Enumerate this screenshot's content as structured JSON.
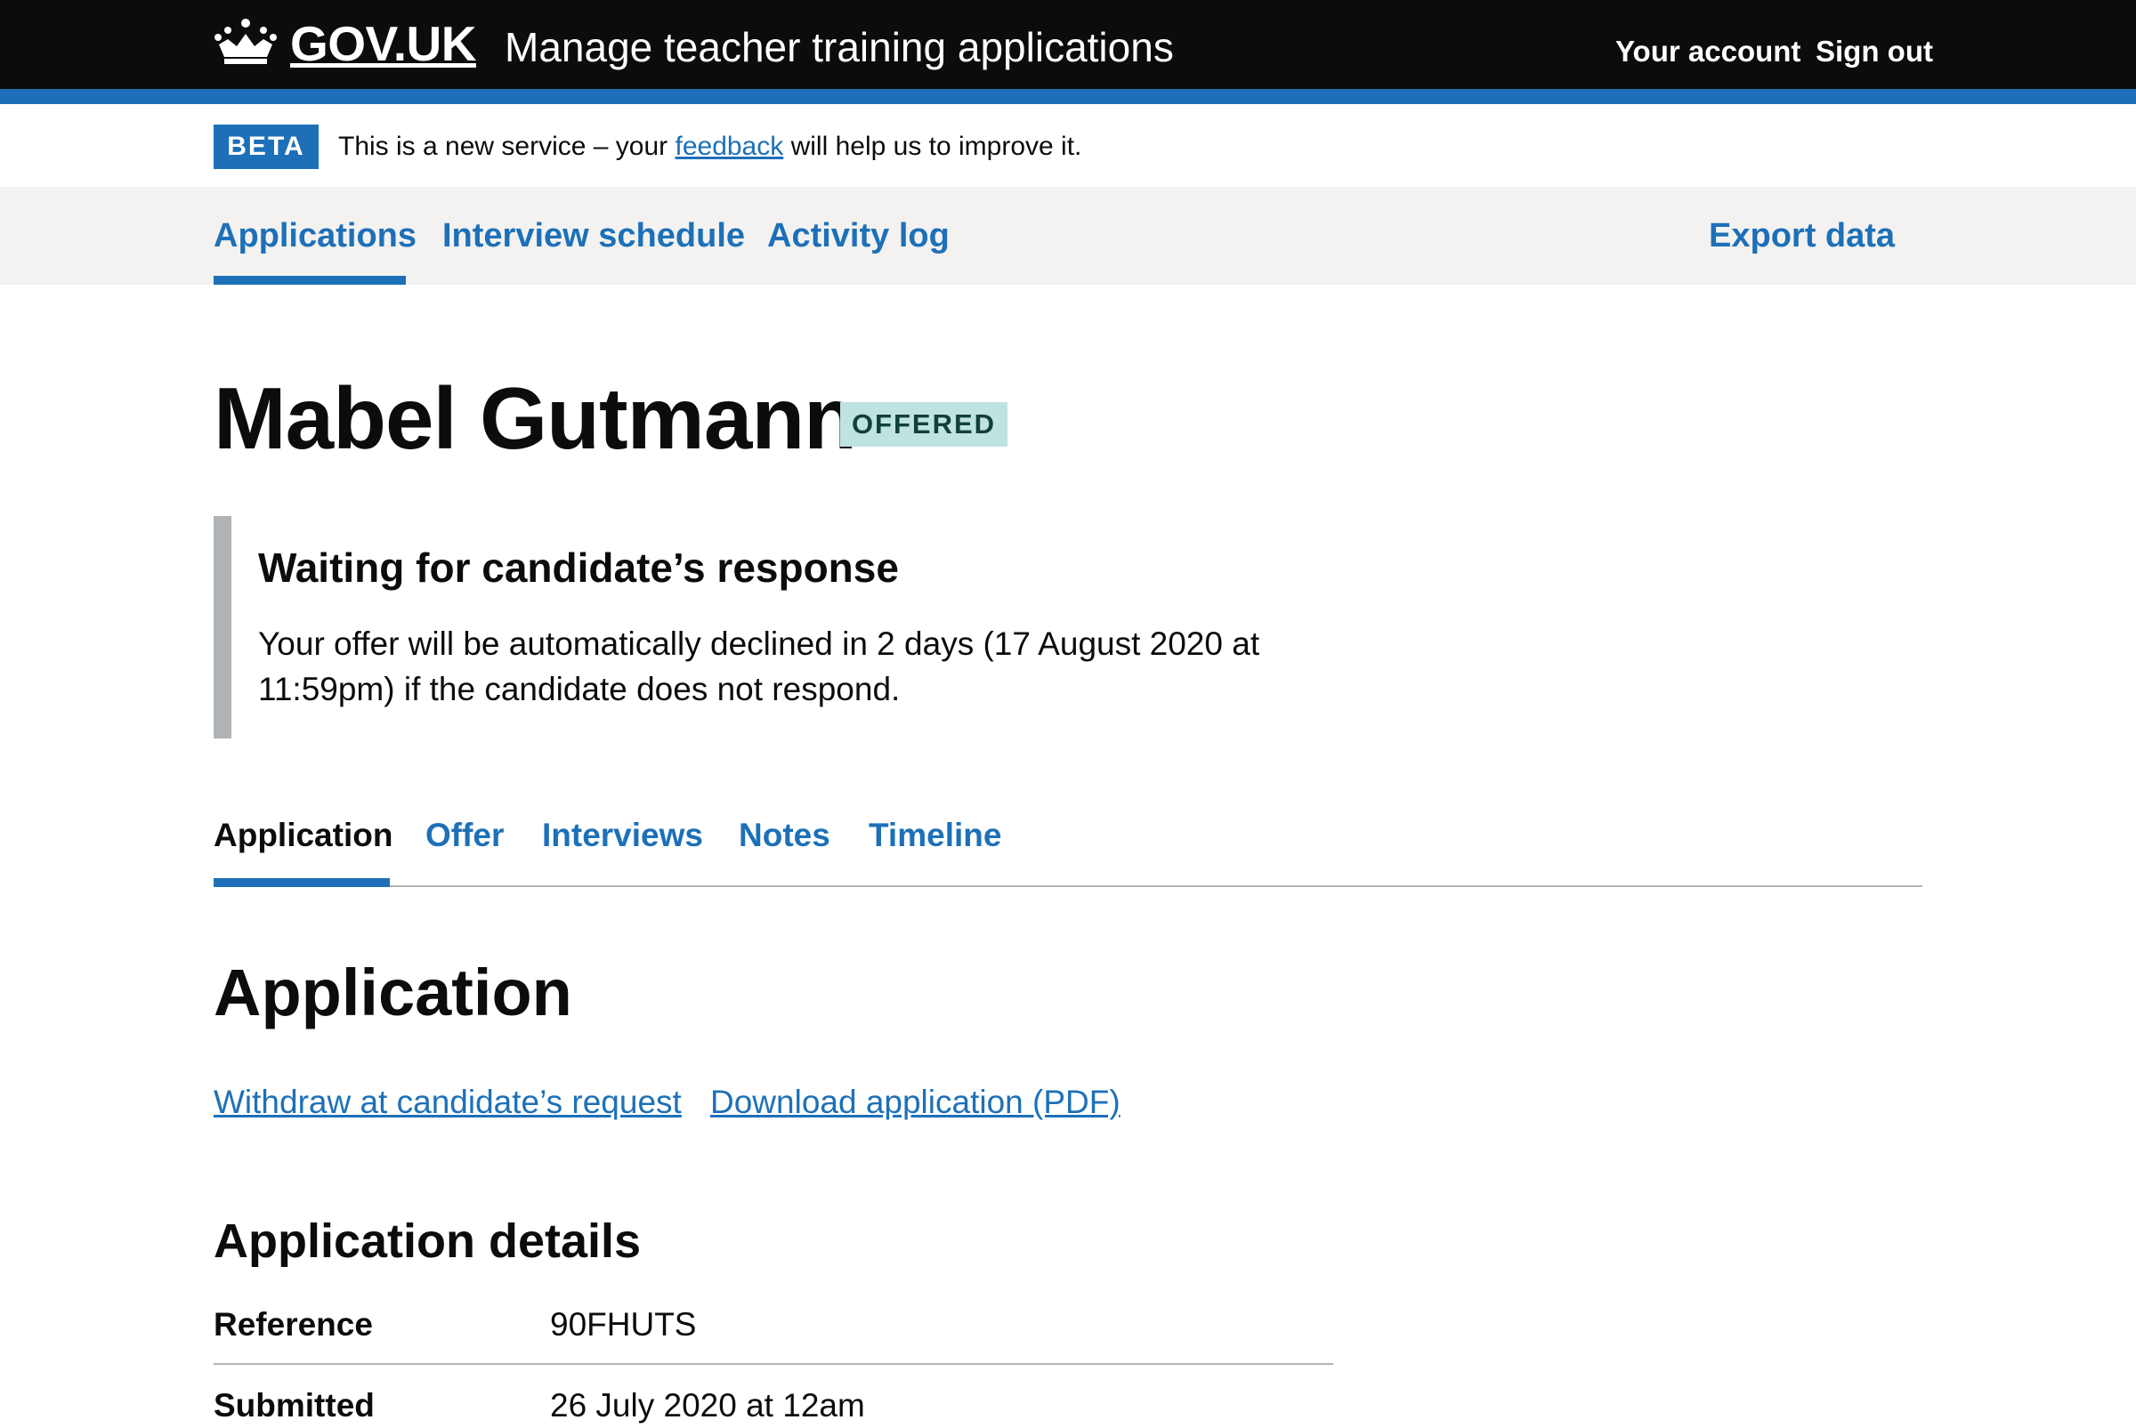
{
  "header": {
    "logo_text": "GOV.UK",
    "service_name": "Manage teacher training applications",
    "links": [
      "Your account",
      "Sign out"
    ]
  },
  "beta": {
    "tag": "BETA",
    "text_before": "This is a new service – your ",
    "link": "feedback",
    "text_after": " will help us to improve it."
  },
  "primary_nav": {
    "items": [
      "Applications",
      "Interview schedule",
      "Activity log"
    ],
    "current": "Applications",
    "export": "Export data"
  },
  "candidate": {
    "name": "Mabel Gutmann",
    "status": "OFFERED"
  },
  "inset": {
    "title": "Waiting for candidate’s response",
    "body": "Your offer will be automatically declined in 2 days (17 August 2020 at 11:59pm) if the candidate does not respond."
  },
  "sub_nav": {
    "items": [
      "Application",
      "Offer",
      "Interviews",
      "Notes",
      "Timeline"
    ],
    "current": "Application"
  },
  "section": {
    "title": "Application",
    "actions": [
      "Withdraw at candidate’s request",
      "Download application (PDF)"
    ]
  },
  "details": {
    "title": "Application details",
    "rows": [
      {
        "key": "Reference",
        "value": "90FHUTS"
      },
      {
        "key": "Submitted",
        "value": "26 July 2020 at 12am"
      }
    ]
  },
  "colors": {
    "header_bg": "#0b0c0c",
    "brand_blue": "#1d70b8",
    "link": "#1d70b8",
    "nav_bg": "#f3f2f1",
    "badge_bg": "#bfe3e0",
    "badge_text": "#10403c",
    "inset_border": "#b1b4b6"
  }
}
